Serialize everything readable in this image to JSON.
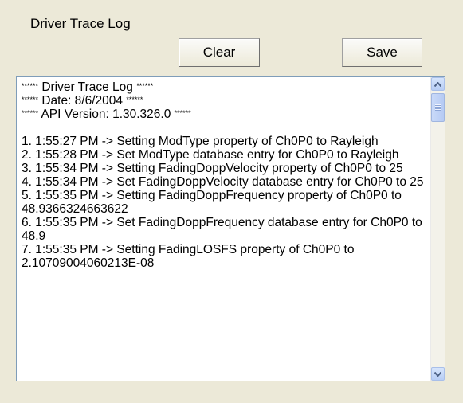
{
  "title": "Driver Trace Log",
  "buttons": {
    "clear": "Clear",
    "save": "Save"
  },
  "log": {
    "header": [
      {
        "prefix": "******",
        "text": " Driver Trace Log ",
        "suffix": "******"
      },
      {
        "prefix": "******",
        "text": " Date: 8/6/2004 ",
        "suffix": "******"
      },
      {
        "prefix": "******",
        "text": " API Version: 1.30.326.0 ",
        "suffix": "******"
      }
    ],
    "entries": [
      "1. 1:55:27 PM -> Setting ModType property of Ch0P0 to Rayleigh",
      "2. 1:55:28 PM -> Set ModType database entry for Ch0P0 to Rayleigh",
      "3. 1:55:34 PM -> Setting FadingDoppVelocity property of Ch0P0 to 25",
      "4. 1:55:34 PM -> Set FadingDoppVelocity database entry for Ch0P0 to 25",
      "5. 1:55:35 PM -> Setting FadingDoppFrequency property of Ch0P0 to 48.9366324663622",
      "6. 1:55:35 PM -> Set FadingDoppFrequency database entry for Ch0P0 to 48.9",
      "7. 1:55:35 PM -> Setting FadingLOSFS property of Ch0P0 to",
      "2.10709004060213E-08"
    ]
  },
  "scrollbar": {
    "up_icon": "arrow-up-icon",
    "down_icon": "arrow-down-icon",
    "position": 0.0
  }
}
